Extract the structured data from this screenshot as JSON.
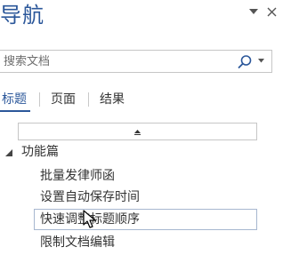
{
  "pane": {
    "title": "导航",
    "options_icon": "chevron-down-icon",
    "close_icon": "close-icon"
  },
  "search": {
    "placeholder": "搜索文档",
    "icon": "search-icon",
    "dropdown_icon": "chevron-down-icon"
  },
  "tabs": [
    {
      "label": "标题",
      "active": true
    },
    {
      "label": "页面",
      "active": false
    },
    {
      "label": "结果",
      "active": false
    }
  ],
  "collapse_bar": {
    "icon": "collapse-up-icon"
  },
  "tree": {
    "parent": {
      "label": "功能篇",
      "expanded": true
    },
    "children": [
      {
        "label": "批量发律师函",
        "selected": false
      },
      {
        "label": "设置自动保存时间",
        "selected": false
      },
      {
        "label": "快速调整标题顺序",
        "selected": true
      },
      {
        "label": "限制文档编辑",
        "selected": false
      }
    ]
  },
  "colors": {
    "accent": "#2b579a",
    "border": "#c6c6c6",
    "selected_border": "#a7b7d0"
  }
}
